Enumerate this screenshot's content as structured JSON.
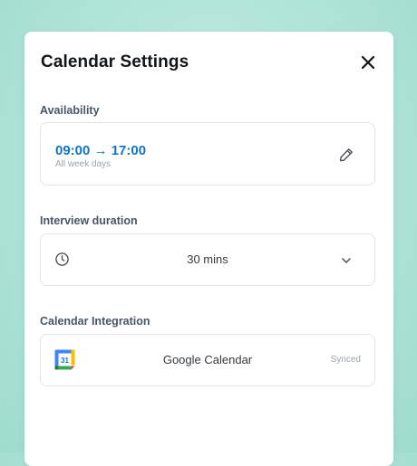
{
  "modal": {
    "title": "Calendar Settings"
  },
  "availability": {
    "label": "Availability",
    "start": "09:00",
    "arrow": "→",
    "end": "17:00",
    "subtitle": "All week days"
  },
  "duration": {
    "label": "Interview duration",
    "value": "30 mins"
  },
  "integration": {
    "label": "Calendar Integration",
    "name": "Google Calendar",
    "status": "Synced",
    "icon_day": "31"
  },
  "icons": {
    "close": "close-icon",
    "edit": "pencil-icon",
    "clock": "clock-icon",
    "chevron": "chevron-down-icon",
    "calendar": "google-calendar-icon"
  },
  "colors": {
    "accent": "#1273c4",
    "background": "#b4e6db"
  }
}
